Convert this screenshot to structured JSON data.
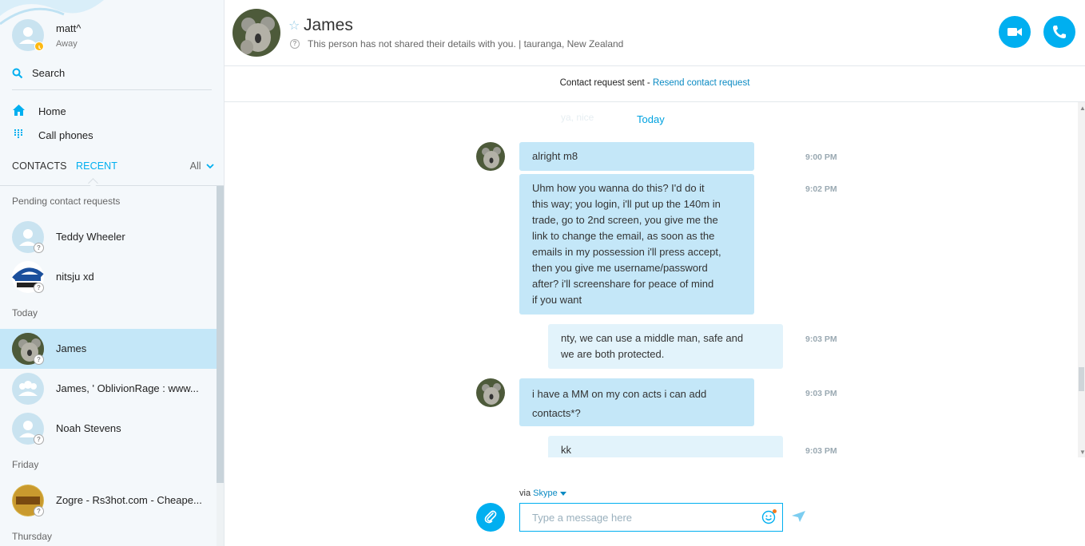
{
  "profile": {
    "name": "matt^",
    "status": "Away"
  },
  "search": {
    "label": "Search"
  },
  "nav": {
    "home": "Home",
    "call_phones": "Call phones"
  },
  "tabs": {
    "contacts": "CONTACTS",
    "recent": "RECENT",
    "filter": "All"
  },
  "groups": {
    "pending": "Pending contact requests",
    "today": "Today",
    "friday": "Friday",
    "thursday": "Thursday"
  },
  "contacts": {
    "teddy": "Teddy Wheeler",
    "nitsju": "nitsju xd",
    "james": "James",
    "group": "James, ' OblivionRage : www...",
    "noah": "Noah Stevens",
    "zogre": "Zogre - Rs3hot.com - Cheape..."
  },
  "header": {
    "name": "James",
    "info": "This person has not shared their details with you.  |  tauranga, New Zealand"
  },
  "banner": {
    "text": "Contact request sent - ",
    "link": "Resend contact request"
  },
  "conversation": {
    "faded_prev": "ya, nice",
    "day": "Today",
    "messages": [
      {
        "text": "alright m8",
        "time": "9:00 PM"
      },
      {
        "text": "Uhm how you wanna do this? I'd do it\nthis way; you login, i'll put up the 140m in\ntrade, go to 2nd screen, you give me the\nlink to change the email, as soon as the\nemails in my possession i'll press accept,\nthen you give me username/password\nafter? i'll screenshare for peace of mind\nif you want",
        "time": "9:02 PM"
      },
      {
        "text": "nty, we can use a middle man, safe and\nwe are both protected.",
        "time": "9:03 PM"
      },
      {
        "text": "i have a MM on my con acts i can add\ncontacts*?",
        "time": "9:03 PM"
      },
      {
        "text": "kk",
        "time": "9:03 PM"
      }
    ]
  },
  "composer": {
    "via": "via ",
    "via_link": "Skype",
    "placeholder": "Type a message here"
  },
  "colors": {
    "accent": "#00aff0",
    "bubble_in": "#c4e7f8",
    "bubble_out": "#e2f3fb",
    "selected": "#c4e7f8"
  }
}
